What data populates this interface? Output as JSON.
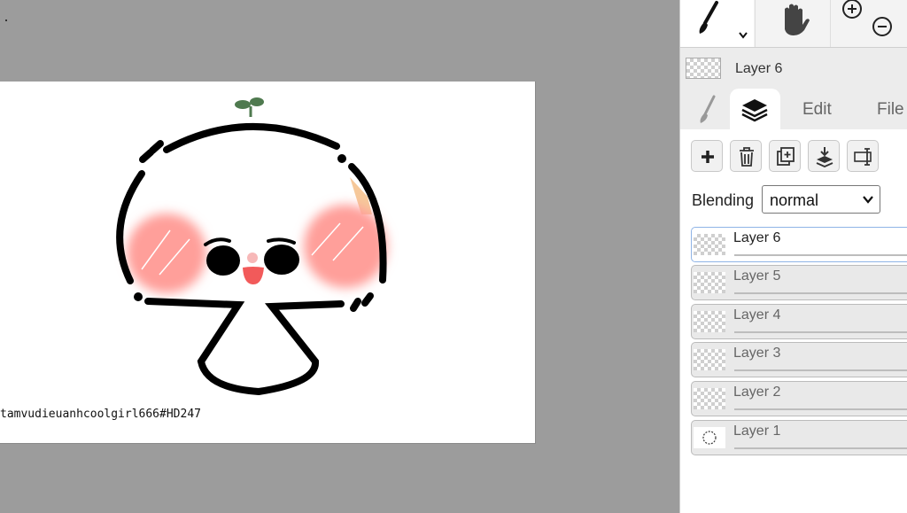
{
  "canvas": {
    "signature": "tamvudieuanhcoolgirl666#HD247"
  },
  "toolbar": {
    "tools": [
      {
        "name": "brush-tool",
        "icon": "brush-icon",
        "dropdown_icon": "chevron-down-icon"
      },
      {
        "name": "hand-tool",
        "icon": "hand-icon"
      },
      {
        "name": "zoom-tool",
        "icons": [
          "zoom-in-icon",
          "zoom-out-icon"
        ]
      }
    ]
  },
  "current_layer": {
    "label": "Layer 6"
  },
  "tabs": {
    "brush_icon": "brush-icon",
    "layers_icon": "layers-icon",
    "edit": "Edit",
    "file": "File"
  },
  "layer_actions": {
    "icons": [
      "add-layer-icon",
      "delete-layer-icon",
      "duplicate-layer-icon",
      "merge-down-icon",
      "rename-layer-icon"
    ]
  },
  "blending": {
    "label": "Blending",
    "value": "normal"
  },
  "layers": [
    {
      "name": "Layer 6",
      "active": true
    },
    {
      "name": "Layer 5",
      "active": false
    },
    {
      "name": "Layer 4",
      "active": false
    },
    {
      "name": "Layer 3",
      "active": false
    },
    {
      "name": "Layer 2",
      "active": false
    },
    {
      "name": "Layer 1",
      "active": false
    }
  ],
  "colors": {
    "workspace": "#9c9c9c",
    "panel": "#ececec",
    "blush": "#ff9f9a",
    "sprout": "#4f7a4f",
    "mouth": "#f25a5a",
    "selection": "#8fb4e6"
  }
}
